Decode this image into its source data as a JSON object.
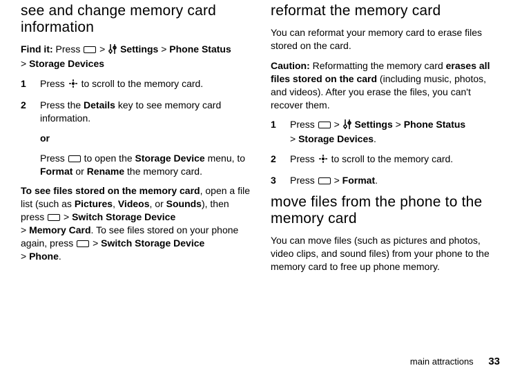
{
  "left": {
    "heading": "see and change memory card information",
    "findit_label": "Find it:",
    "findit_press": " Press ",
    "gt": " > ",
    "settings": "Settings",
    "phone_status": "Phone Status",
    "storage_devices": "Storage Devices",
    "step1_num": "1",
    "step1_a": "Press ",
    "step1_b": " to scroll to the memory card.",
    "step2_num": "2",
    "step2_a": "Press the ",
    "step2_details": "Details",
    "step2_b": " key to see memory card information.",
    "or": "or",
    "step2c_a": "Press ",
    "step2c_b": " to open the ",
    "step2c_storage_device": "Storage Device",
    "step2c_c": " menu, to ",
    "step2c_format": "Format",
    "step2c_or": " or ",
    "step2c_rename": "Rename",
    "step2c_d": " the memory card.",
    "p2_lead": "To see files stored on the memory card",
    "p2_a": ", open a file list (such as ",
    "p2_pictures": "Pictures",
    "p2_comma1": ", ",
    "p2_videos": "Videos",
    "p2_comma2": ", or ",
    "p2_sounds": "Sounds",
    "p2_b": "), then press ",
    "p2_switch1": "Switch Storage Device",
    "p2_memory_card": "Memory Card",
    "p2_c": ". To see files stored on your phone again, press ",
    "p2_switch2": "Switch Storage Device",
    "p2_phone": "Phone",
    "p2_period": "."
  },
  "right": {
    "heading1": "reformat the memory card",
    "p1": "You can reformat your memory card to erase files stored on the card.",
    "caution_label": "Caution:",
    "caution_a": " Reformatting the memory card ",
    "caution_bold": "erases all files stored on the card",
    "caution_b": " (including music, photos, and videos). After you erase the files, you can't recover them.",
    "step1_num": "1",
    "step1_a": "Press ",
    "settings": "Settings",
    "phone_status": "Phone Status",
    "storage_devices": "Storage Devices",
    "period": ".",
    "step2_num": "2",
    "step2_a": "Press ",
    "step2_b": " to scroll to the memory card.",
    "step3_num": "3",
    "step3_a": "Press ",
    "step3_format": "Format",
    "heading2": "move files from the phone to the memory card",
    "p2": "You can move files (such as pictures and photos, video clips, and sound files) from your phone to the memory card to free up phone memory."
  },
  "gt": ">",
  "footer": {
    "section": "main attractions",
    "page": "33"
  }
}
